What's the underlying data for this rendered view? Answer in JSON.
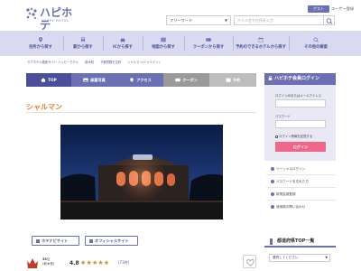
{
  "header": {
    "logo_text": "ハピホテ",
    "logo_sub": "HAPPY HOTEL",
    "guest_label": "ゲスト",
    "user_register": "ユーザー登録",
    "freeword_label": "フリーワード",
    "search_placeholder": "ホテル名や住所を入力",
    "colors": {
      "brand": "#6b6fb3",
      "nav_bg": "#d9daf0",
      "accent": "#f07e2b",
      "pink": "#f0668a"
    }
  },
  "nav": {
    "items": [
      {
        "label": "住所から探す",
        "icon": "pin-icon"
      },
      {
        "label": "駅から探す",
        "icon": "train-icon"
      },
      {
        "label": "ICから探す",
        "icon": "car-icon"
      },
      {
        "label": "地図から探す",
        "icon": "map-icon"
      },
      {
        "label": "クーポンから探す",
        "icon": "coupon-icon"
      },
      {
        "label": "予約のできるホテルから探す",
        "icon": "calendar-icon"
      },
      {
        "label": "その他の検索",
        "icon": "search-icon"
      }
    ]
  },
  "breadcrumb": [
    "ラブホテル検索サイト ハッピーホテル",
    "栃木県",
    "下都賀郡壬生町",
    "シャルマン(シャルマン)"
  ],
  "tabs": [
    {
      "label": "TOP",
      "icon": "home-icon",
      "active": true
    },
    {
      "label": "部屋写真",
      "icon": "photo-icon",
      "active": false
    },
    {
      "label": "アクセス",
      "icon": "access-icon",
      "active": false
    },
    {
      "label": "クーポン",
      "icon": "coupon-icon",
      "active": false
    },
    {
      "label": "予約",
      "icon": "calendar-icon",
      "active": false
    }
  ],
  "shop": {
    "name": "シャルマン",
    "homepage_button": "ホテナビサイト",
    "official_button": "オフィシャルサイト",
    "rank_label": "33",
    "rank_unit": "位",
    "rank_sub": "(栃木県)",
    "score": "4.8",
    "rating": 0.85,
    "review_count": "(73件)"
  },
  "sidebar": {
    "login_title": "ハピホテ会員ログイン",
    "login_id_label": "ログインIDまたはメールアドレス",
    "password_label": "パスワード",
    "remember_label": "ログイン情報を記憶する",
    "login_button": "ログイン",
    "links": [
      "ソーシャルログイン",
      "パスワードを忘れた方",
      "新規会員登録",
      "使用時お問い合わせ"
    ],
    "pref_title": "都道府県TOP一覧",
    "pref_select": "選択してください"
  }
}
